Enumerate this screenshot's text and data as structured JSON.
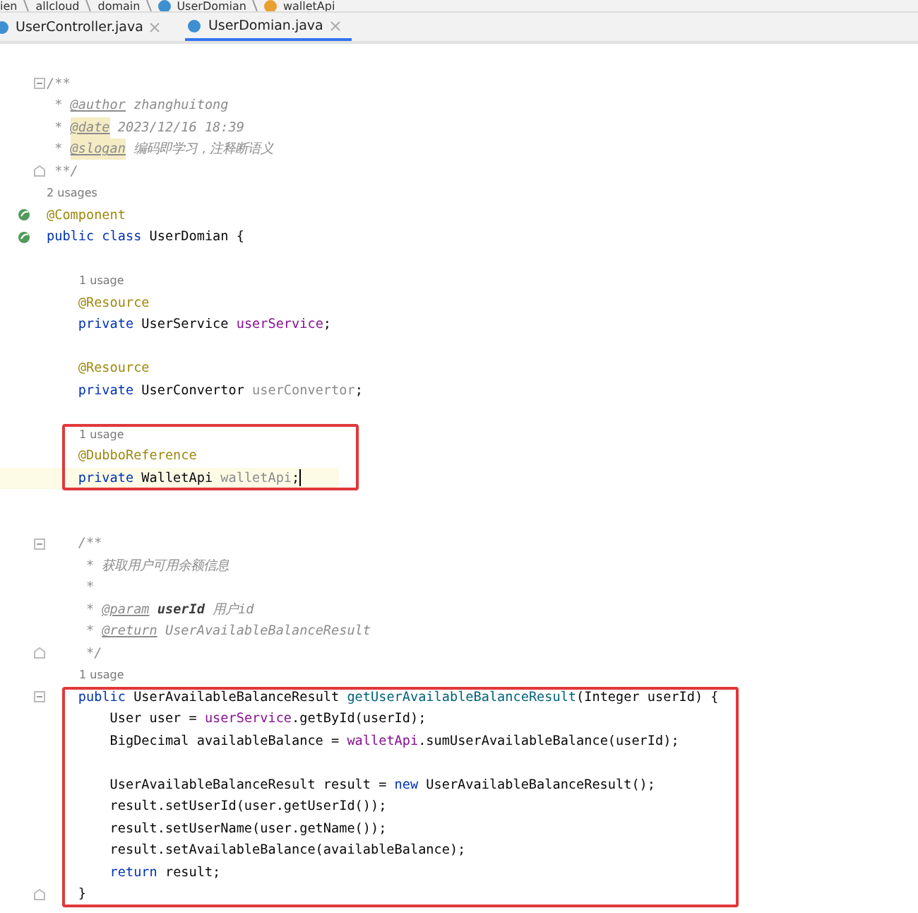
{
  "breadcrumbs": [
    "ien",
    "allcloud",
    "domain",
    "UserDomian",
    "walletApi"
  ],
  "tabs": [
    {
      "label": "UserController.java",
      "selected": false
    },
    {
      "label": "UserDomian.java",
      "selected": true
    }
  ],
  "blocks": [
    {
      "highlighted": false,
      "lines": [
        {
          "kind": "blank"
        },
        {
          "kind": "code",
          "fold_start": true,
          "tokens": [
            {
              "kind": "comment",
              "text": "/**"
            }
          ]
        },
        {
          "kind": "code",
          "tokens": [
            {
              "kind": "comment",
              "text": " * "
            },
            {
              "kind": "doctag",
              "text": "@author"
            },
            {
              "kind": "comment",
              "text": " zhanghuitong"
            }
          ]
        },
        {
          "kind": "code",
          "tokens": [
            {
              "kind": "comment",
              "text": " * "
            },
            {
              "kind": "doctag-hl",
              "text": "@date"
            },
            {
              "kind": "comment",
              "text": " 2023/12/16 18:39"
            }
          ]
        },
        {
          "kind": "code",
          "tokens": [
            {
              "kind": "comment",
              "text": " * "
            },
            {
              "kind": "doctag-hl",
              "text": "@slogan"
            },
            {
              "kind": "comment",
              "text": " 编码即学习，注释断语义"
            }
          ]
        },
        {
          "kind": "code",
          "fold_end": true,
          "tokens": [
            {
              "kind": "comment",
              "text": " **/"
            }
          ]
        },
        {
          "kind": "usage",
          "text": "2 usages"
        },
        {
          "kind": "code",
          "bean_icon": true,
          "tokens": [
            {
              "kind": "annotation",
              "text": "@Component"
            }
          ]
        },
        {
          "kind": "code",
          "bean_icon": true,
          "tokens": [
            {
              "kind": "keyword",
              "text": "public class "
            },
            {
              "kind": "plain",
              "text": "UserDomian {"
            }
          ]
        },
        {
          "kind": "blank"
        },
        {
          "kind": "usage",
          "text": "1 usage",
          "indent": true
        },
        {
          "kind": "code",
          "tokens": [
            {
              "kind": "annotation",
              "text": "    @Resource"
            }
          ]
        },
        {
          "kind": "code",
          "tokens": [
            {
              "kind": "keyword",
              "text": "    private "
            },
            {
              "kind": "plain",
              "text": "UserService "
            },
            {
              "kind": "field",
              "text": "userService"
            },
            {
              "kind": "plain",
              "text": ";"
            }
          ]
        },
        {
          "kind": "blank"
        },
        {
          "kind": "code",
          "tokens": [
            {
              "kind": "annotation",
              "text": "    @Resource"
            }
          ]
        },
        {
          "kind": "code",
          "tokens": [
            {
              "kind": "keyword",
              "text": "    private "
            },
            {
              "kind": "plain",
              "text": "UserConvertor "
            },
            {
              "kind": "unused",
              "text": "userConvertor"
            },
            {
              "kind": "plain",
              "text": ";"
            }
          ]
        },
        {
          "kind": "blank"
        }
      ]
    },
    {
      "highlighted": true,
      "lines": [
        {
          "kind": "usage",
          "text": "1 usage",
          "indent": true
        },
        {
          "kind": "code",
          "tokens": [
            {
              "kind": "annotation",
              "text": "    @DubboReference"
            }
          ]
        },
        {
          "kind": "code",
          "current": true,
          "tokens": [
            {
              "kind": "keyword",
              "text": "    private "
            },
            {
              "kind": "plain",
              "text": "WalletApi "
            },
            {
              "kind": "unused",
              "text": "walletApi"
            },
            {
              "kind": "plain",
              "text": ";"
            }
          ]
        }
      ]
    },
    {
      "highlighted": false,
      "lines": [
        {
          "kind": "blank"
        },
        {
          "kind": "blank"
        },
        {
          "kind": "code",
          "fold_start": true,
          "tokens": [
            {
              "kind": "comment",
              "text": "    /**"
            }
          ]
        },
        {
          "kind": "code",
          "tokens": [
            {
              "kind": "comment",
              "text": "     * 获取用户可用余额信息"
            }
          ]
        },
        {
          "kind": "code",
          "tokens": [
            {
              "kind": "comment",
              "text": "     *"
            }
          ]
        },
        {
          "kind": "code",
          "tokens": [
            {
              "kind": "comment",
              "text": "     * "
            },
            {
              "kind": "doctag",
              "text": "@param"
            },
            {
              "kind": "param",
              "text": " userId"
            },
            {
              "kind": "comment",
              "text": " 用户id"
            }
          ]
        },
        {
          "kind": "code",
          "tokens": [
            {
              "kind": "comment",
              "text": "     * "
            },
            {
              "kind": "doctag",
              "text": "@return"
            },
            {
              "kind": "comment",
              "text": " UserAvailableBalanceResult"
            }
          ]
        },
        {
          "kind": "code",
          "fold_end": true,
          "tokens": [
            {
              "kind": "comment",
              "text": "     */"
            }
          ]
        },
        {
          "kind": "usage",
          "text": "1 usage",
          "indent": true
        }
      ]
    },
    {
      "highlighted": true,
      "lines": [
        {
          "kind": "code",
          "fold_start": true,
          "tokens": [
            {
              "kind": "keyword",
              "text": "    public "
            },
            {
              "kind": "plain",
              "text": "UserAvailableBalanceResult "
            },
            {
              "kind": "method",
              "text": "getUserAvailableBalanceResult"
            },
            {
              "kind": "plain",
              "text": "(Integer userId) {"
            }
          ]
        },
        {
          "kind": "code",
          "tokens": [
            {
              "kind": "plain",
              "text": "        User user = "
            },
            {
              "kind": "field",
              "text": "userService"
            },
            {
              "kind": "plain",
              "text": ".getById(userId);"
            }
          ]
        },
        {
          "kind": "code",
          "tokens": [
            {
              "kind": "plain",
              "text": "        BigDecimal availableBalance = "
            },
            {
              "kind": "field",
              "text": "walletApi"
            },
            {
              "kind": "plain",
              "text": ".sumUserAvailableBalance(userId);"
            }
          ]
        },
        {
          "kind": "blank"
        },
        {
          "kind": "code",
          "tokens": [
            {
              "kind": "plain",
              "text": "        UserAvailableBalanceResult result = "
            },
            {
              "kind": "keyword",
              "text": "new "
            },
            {
              "kind": "plain",
              "text": "UserAvailableBalanceResult();"
            }
          ]
        },
        {
          "kind": "code",
          "tokens": [
            {
              "kind": "plain",
              "text": "        result.setUserId(user.getUserId());"
            }
          ]
        },
        {
          "kind": "code",
          "tokens": [
            {
              "kind": "plain",
              "text": "        result.setUserName(user.getName());"
            }
          ]
        },
        {
          "kind": "code",
          "tokens": [
            {
              "kind": "plain",
              "text": "        result.setAvailableBalance(availableBalance);"
            }
          ]
        },
        {
          "kind": "code",
          "tokens": [
            {
              "kind": "keyword",
              "text": "        return "
            },
            {
              "kind": "plain",
              "text": "result;"
            }
          ]
        },
        {
          "kind": "code",
          "fold_end": true,
          "tokens": [
            {
              "kind": "plain",
              "text": "    }"
            }
          ]
        }
      ]
    }
  ]
}
